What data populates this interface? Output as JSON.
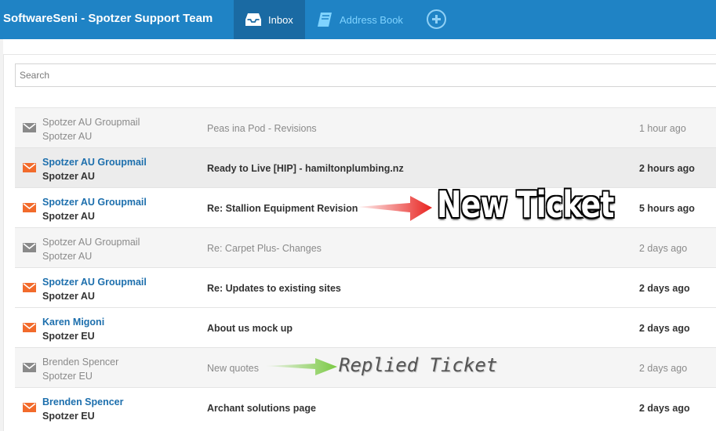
{
  "topbar": {
    "title": "SoftwareSeni - Spotzer Support Team",
    "tabs": [
      {
        "label": "Inbox",
        "icon": "inbox-icon",
        "active": true
      },
      {
        "label": "Address Book",
        "icon": "address-book-icon",
        "active": false
      }
    ],
    "add_icon": "plus-circle-icon",
    "colors": {
      "bar": "#1f83c5",
      "active_tab": "#1a6aa3",
      "inactive_tab_text": "#7fd3ff"
    }
  },
  "search": {
    "placeholder": "Search",
    "value": ""
  },
  "tickets": [
    {
      "sender": "Spotzer AU Groupmail",
      "team": "Spotzer AU",
      "subject": "Peas ina Pod - Revisions",
      "time": "1 hour ago",
      "status": "read"
    },
    {
      "sender": "Spotzer AU Groupmail",
      "team": "Spotzer AU",
      "subject": "Ready to Live [HIP] - hamiltonplumbing.nz",
      "time": "2 hours ago",
      "status": "unread"
    },
    {
      "sender": "Spotzer AU Groupmail",
      "team": "Spotzer AU",
      "subject": "Re: Stallion Equipment Revision",
      "time": "5 hours ago",
      "status": "unread"
    },
    {
      "sender": "Spotzer AU Groupmail",
      "team": "Spotzer AU",
      "subject": "Re: Carpet Plus- Changes",
      "time": "2 days ago",
      "status": "read"
    },
    {
      "sender": "Spotzer AU Groupmail",
      "team": "Spotzer AU",
      "subject": "Re: Updates to existing sites",
      "time": "2 days ago",
      "status": "unread"
    },
    {
      "sender": "Karen Migoni",
      "team": "Spotzer EU",
      "subject": "About us mock up",
      "time": "2 days ago",
      "status": "unread"
    },
    {
      "sender": "Brenden Spencer",
      "team": "Spotzer EU",
      "subject": "New quotes",
      "time": "2 days ago",
      "status": "read"
    },
    {
      "sender": "Brenden Spencer",
      "team": "Spotzer EU",
      "subject": "Archant solutions page",
      "time": "2 days ago",
      "status": "unread"
    }
  ],
  "annotations": {
    "new_ticket": "New Ticket",
    "replied_ticket": "Replied Ticket",
    "new_arrow_color": "#e8231f",
    "replied_arrow_color": "#7ac943"
  },
  "icon_colors": {
    "unread_envelope": "#f26b2c",
    "read_envelope": "#8a8a8a"
  }
}
